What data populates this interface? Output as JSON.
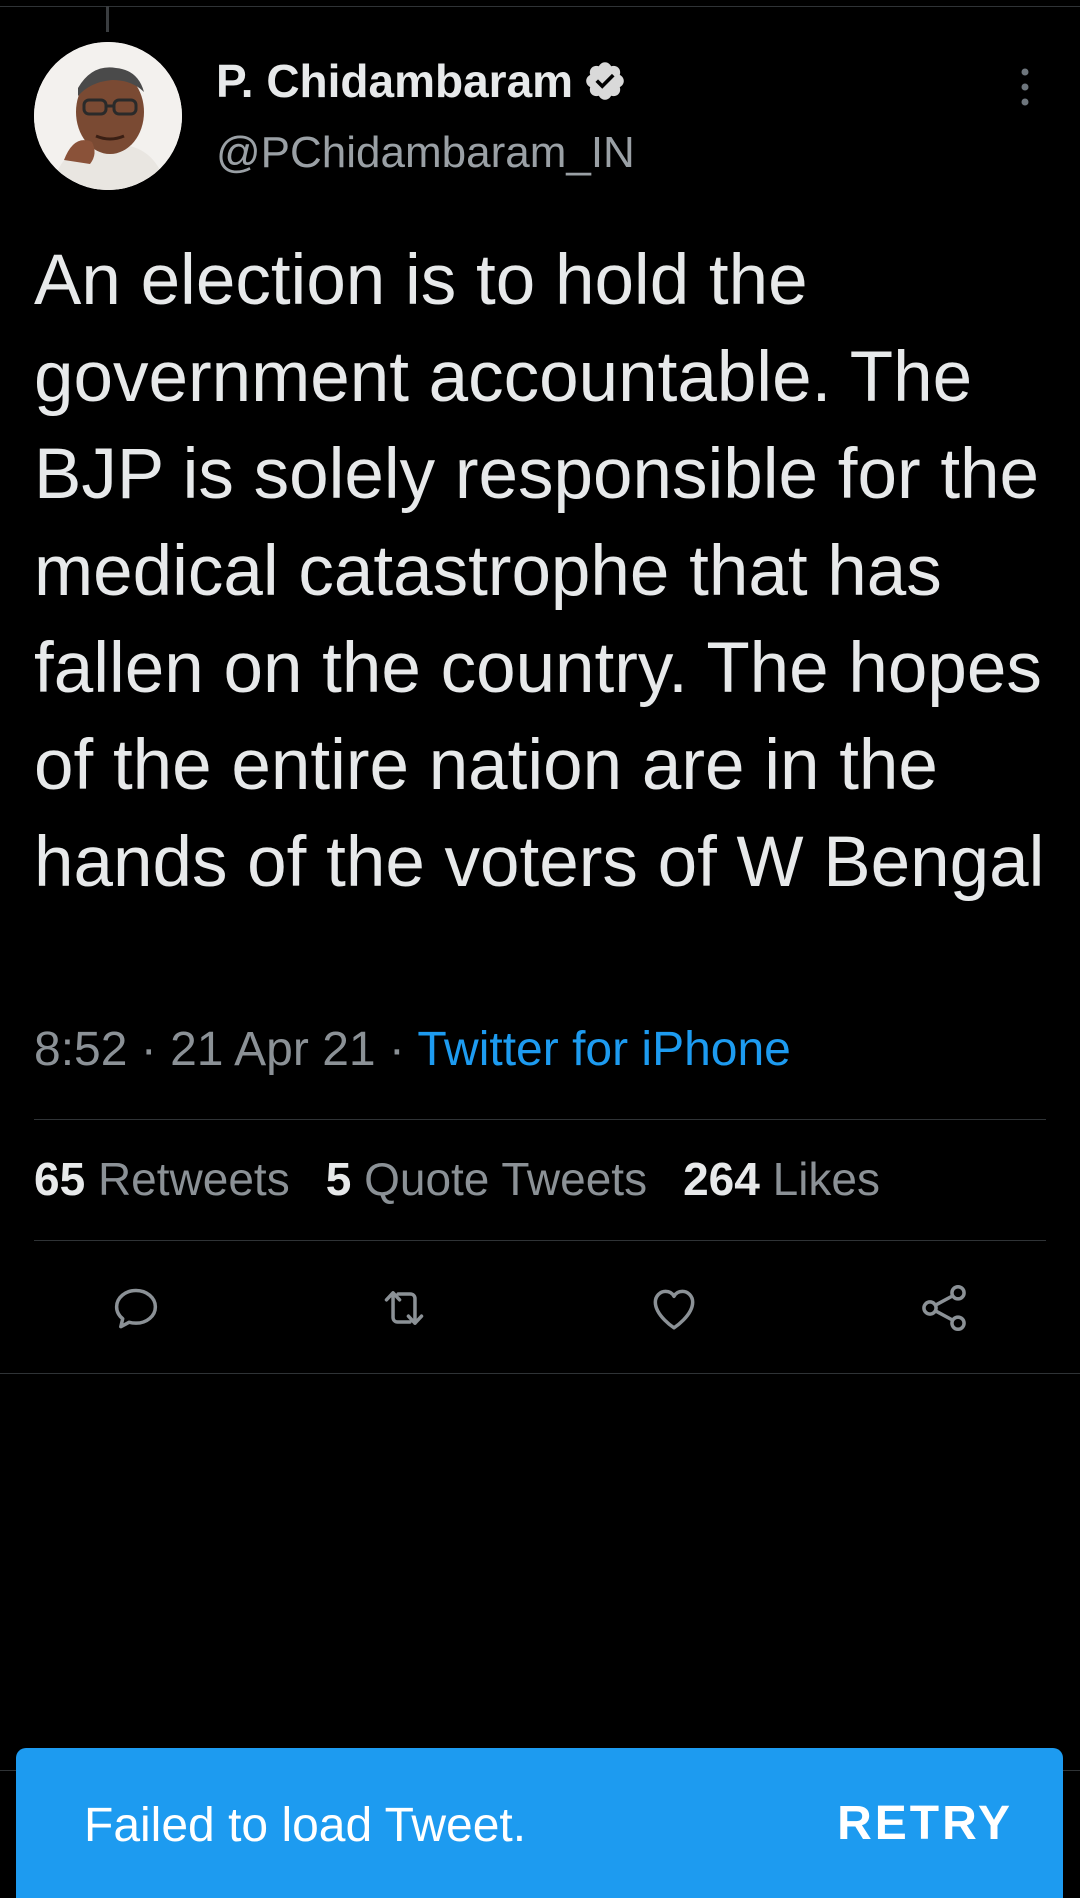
{
  "tweet": {
    "author": {
      "display_name": "P. Chidambaram",
      "handle": "@PChidambaram_IN",
      "verified": true
    },
    "text": "An election is to hold the government accountable. The BJP is solely responsible for the medical catastrophe that has fallen on the country. The hopes of the entire nation are in the hands of the voters of W Bengal",
    "meta": {
      "time": "8:52",
      "date": "21 Apr 21",
      "source": "Twitter for iPhone",
      "separator": " · "
    },
    "stats": {
      "retweets_count": "65",
      "retweets_label": "Retweets",
      "quotes_count": "5",
      "quotes_label": "Quote Tweets",
      "likes_count": "264",
      "likes_label": "Likes"
    },
    "actions": [
      "reply-icon",
      "retweet-icon",
      "like-icon",
      "share-icon"
    ]
  },
  "toast": {
    "message": "Failed to load Tweet.",
    "action": "RETRY"
  },
  "colors": {
    "background": "#000000",
    "text_primary": "#e7e9ea",
    "text_secondary": "#8b9196",
    "accent": "#1d9bf0",
    "divider": "#2f3336",
    "icon": "#8b9196"
  }
}
